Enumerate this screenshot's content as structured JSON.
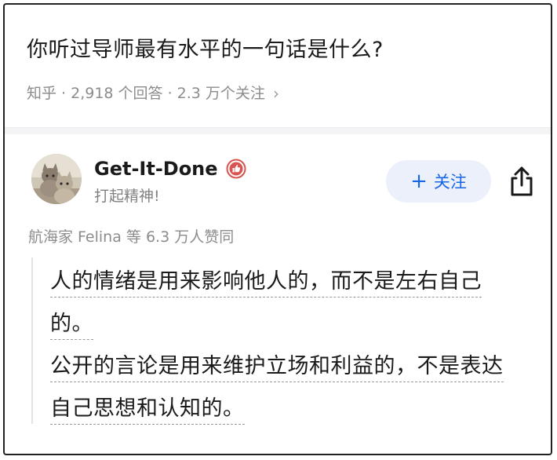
{
  "question": {
    "title": "你听过导师最有水平的一句话是什么?",
    "meta": "知乎 · 2,918 个回答 · 2.3 万个关注",
    "chevron_icon": "chevron-right-icon"
  },
  "answer": {
    "author_name": "Get-It-Done",
    "author_badge_icon": "thumbs-up-badge-icon",
    "author_bio": "打起精神!",
    "follow_label": "关注",
    "follow_plus": "+",
    "share_icon": "share-icon",
    "upvote_text": "航海家 Felina 等 6.3 万人赞同",
    "quote_lines": [
      "人的情绪是用来影响他人的，而不是左右自己",
      "的。",
      "公开的言论是用来维护立场和利益的，不是表达",
      "自己思想和认知的。"
    ]
  },
  "colors": {
    "accent": "#1766e5",
    "follow_bg": "#ebf0fb",
    "badge": "#d9534f",
    "muted_text": "#8c8c8c"
  }
}
